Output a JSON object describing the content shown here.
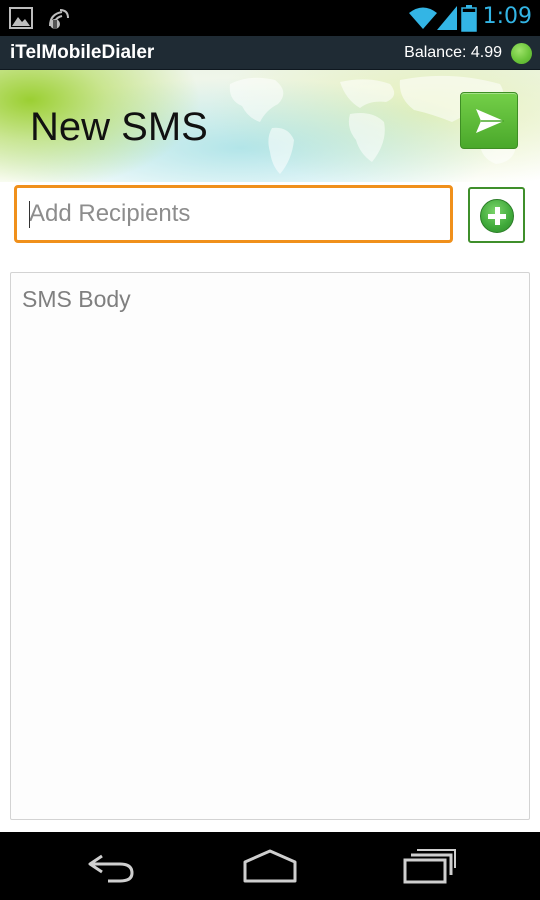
{
  "status_bar": {
    "time": "1:09",
    "icons": [
      "gallery-icon",
      "broadcast-icon",
      "wifi-icon",
      "signal-icon",
      "battery-icon"
    ]
  },
  "title_bar": {
    "app_name": "iTelMobileDialer",
    "balance": "Balance: 4.99",
    "status_color": "#6cc53b"
  },
  "header": {
    "title": "New SMS",
    "send_icon": "send-icon"
  },
  "recipients": {
    "placeholder": "Add Recipients",
    "value": "",
    "add_icon": "add-circle-icon"
  },
  "sms_body": {
    "placeholder": "SMS Body",
    "value": ""
  },
  "nav_bar": {
    "icons": [
      "back-icon",
      "home-icon",
      "recent-apps-icon"
    ]
  },
  "colors": {
    "accent_orange": "#f0901b",
    "accent_green": "#5cbb38",
    "holo_blue": "#33b5e5",
    "title_bar_bg": "#1f2b34"
  }
}
